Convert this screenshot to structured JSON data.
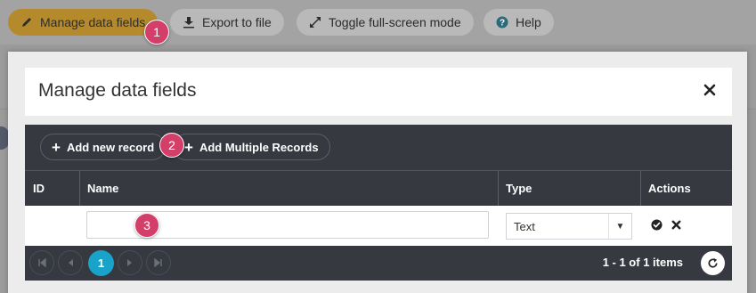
{
  "background": {
    "toolbar_buttons": [
      {
        "label": "Manage data fields",
        "icon": "pencil-icon",
        "active": true
      },
      {
        "label": "Export to file",
        "icon": "download-icon"
      },
      {
        "label": "Toggle full-screen mode",
        "icon": "expand-icon"
      },
      {
        "label": "Help",
        "icon": "question-circle-icon"
      }
    ]
  },
  "modal": {
    "title": "Manage data fields",
    "close_icon": "close-icon",
    "toolbar": {
      "add_record": "Add new record",
      "add_multiple": "Add Multiple Records"
    },
    "columns": [
      "ID",
      "Name",
      "Type",
      "Actions"
    ],
    "rows": [
      {
        "id": "",
        "name": "",
        "type": "Text"
      }
    ],
    "pager": {
      "current_page": "1",
      "info": "1 - 1 of 1 items"
    }
  },
  "annotations": [
    "1",
    "2",
    "3"
  ],
  "colors": {
    "accent": "#19a3c9",
    "dark": "#363940",
    "badge": "#d43f6a",
    "active_button": "#b58a2d"
  }
}
